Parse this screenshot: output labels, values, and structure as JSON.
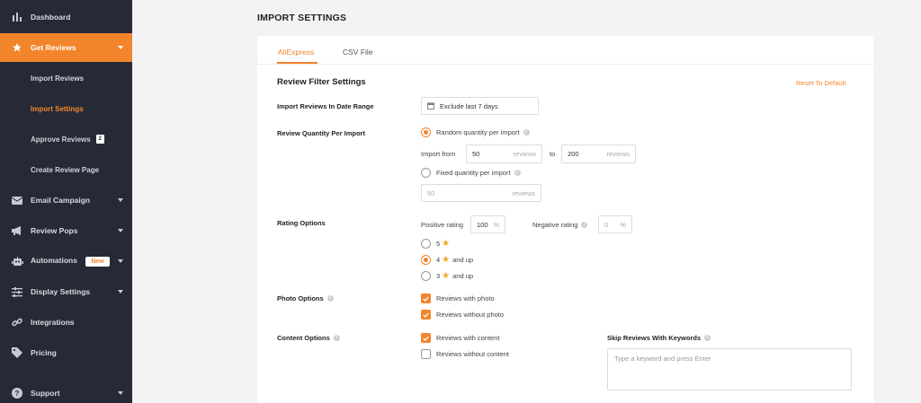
{
  "sidebar": {
    "items": [
      {
        "label": "Dashboard",
        "icon": "bar-chart-icon"
      },
      {
        "label": "Get Reviews",
        "icon": "star-icon",
        "active": true
      },
      {
        "label": "Email Campaign",
        "icon": "envelope-icon"
      },
      {
        "label": "Review Pops",
        "icon": "megaphone-icon"
      },
      {
        "label": "Automations",
        "icon": "robot-icon",
        "badge": "New"
      },
      {
        "label": "Display Settings",
        "icon": "sliders-icon"
      },
      {
        "label": "Integrations",
        "icon": "link-icon"
      },
      {
        "label": "Pricing",
        "icon": "tag-icon"
      },
      {
        "label": "Support",
        "icon": "question-icon"
      }
    ],
    "sub_items": [
      {
        "label": "Import Reviews"
      },
      {
        "label": "Import Settings",
        "active": true
      },
      {
        "label": "Approve Reviews",
        "count": "2"
      },
      {
        "label": "Create Review Page"
      }
    ]
  },
  "page": {
    "title": "IMPORT SETTINGS"
  },
  "tabs": [
    {
      "label": "AliExpress",
      "active": true
    },
    {
      "label": "CSV File"
    }
  ],
  "filter": {
    "section_title": "Review Filter Settings",
    "reset_label": "Reset To Default",
    "date_range": {
      "label": "Import Reviews In Date Range",
      "value": "Exclude last 7 days"
    },
    "quantity": {
      "label": "Review Quantity Per Import",
      "random_label": "Random quantity per import",
      "import_from_label": "Import from",
      "from_value": "50",
      "to_label": "to",
      "to_value": "200",
      "unit": "reviews",
      "fixed_label": "Fixed quantity per import",
      "fixed_value": "50",
      "selected": "random"
    },
    "rating": {
      "label": "Rating Options",
      "positive_label": "Positive rating",
      "positive_value": "100",
      "negative_label": "Negative rating",
      "negative_value": "0",
      "percent": "%",
      "options": [
        {
          "num": "5",
          "suffix": "",
          "selected": false
        },
        {
          "num": "4",
          "suffix": "and up",
          "selected": true
        },
        {
          "num": "3",
          "suffix": "and up",
          "selected": false
        }
      ]
    },
    "photo": {
      "label": "Photo Options",
      "with_photo": "Reviews with photo",
      "without_photo": "Reviews without photo"
    },
    "content": {
      "label": "Content Options",
      "with_content": "Reviews with content",
      "without_content": "Reviews without content"
    },
    "keywords": {
      "label": "Skip Reviews With Keywords",
      "placeholder": "Type a keyword and press Enter"
    }
  },
  "colors": {
    "accent": "#f2852b",
    "sidebar_bg": "#262a36",
    "star": "#f5a623"
  }
}
